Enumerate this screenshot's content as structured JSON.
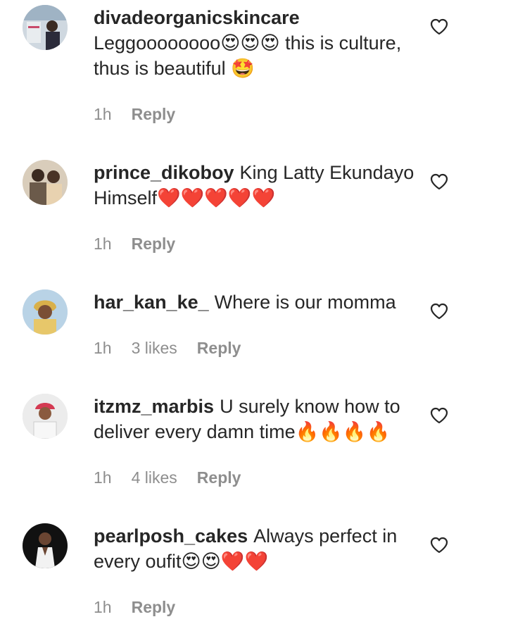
{
  "comments": [
    {
      "username": "divadeorganicskincare",
      "text": "Leggoooooooo😍😍😍 this is culture, thus is beautiful 🤩",
      "time": "1h",
      "likes": "",
      "reply_label": "Reply",
      "username_block": true
    },
    {
      "username": "prince_dikoboy",
      "text": "King Latty Ekundayo Himself❤️❤️❤️❤️❤️",
      "time": "1h",
      "likes": "",
      "reply_label": "Reply"
    },
    {
      "username": "har_kan_ke_",
      "text": "Where is our momma",
      "time": "1h",
      "likes": "3 likes",
      "reply_label": "Reply"
    },
    {
      "username": "itzmz_marbis",
      "text": "U surely know how to deliver every damn time🔥🔥🔥🔥",
      "time": "1h",
      "likes": "4 likes",
      "reply_label": "Reply"
    },
    {
      "username": "pearlposh_cakes",
      "text": "Always perfect in every oufit😍😍❤️❤️",
      "time": "1h",
      "likes": "",
      "reply_label": "Reply"
    }
  ],
  "icons": {
    "heart": "heart-outline-icon"
  },
  "colors": {
    "text": "#262626",
    "meta": "#8e8e8e",
    "background": "#ffffff"
  }
}
